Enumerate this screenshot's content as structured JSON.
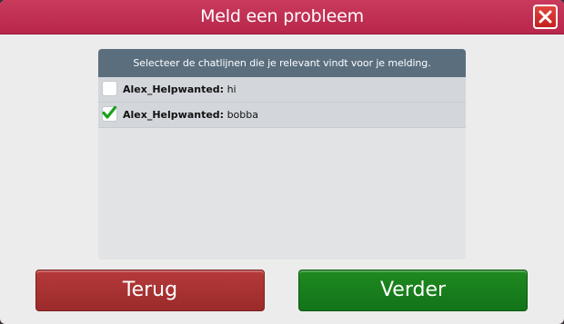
{
  "dialog": {
    "title": "Meld een probleem",
    "close_icon": "close-icon"
  },
  "panel": {
    "header": "Selecteer de chatlijnen die je relevant vindt voor je melding.",
    "lines": [
      {
        "user": "Alex_Helpwanted:",
        "message": "hi",
        "checked": false
      },
      {
        "user": "Alex_Helpwanted:",
        "message": "bobba",
        "checked": true
      }
    ]
  },
  "buttons": {
    "back_label": "Terug",
    "next_label": "Verder"
  },
  "colors": {
    "titlebar": "#c0304f",
    "panel_header": "#5a6e7e",
    "back_button": "#a83232",
    "next_button": "#187f1c",
    "check": "#1aa01a"
  }
}
